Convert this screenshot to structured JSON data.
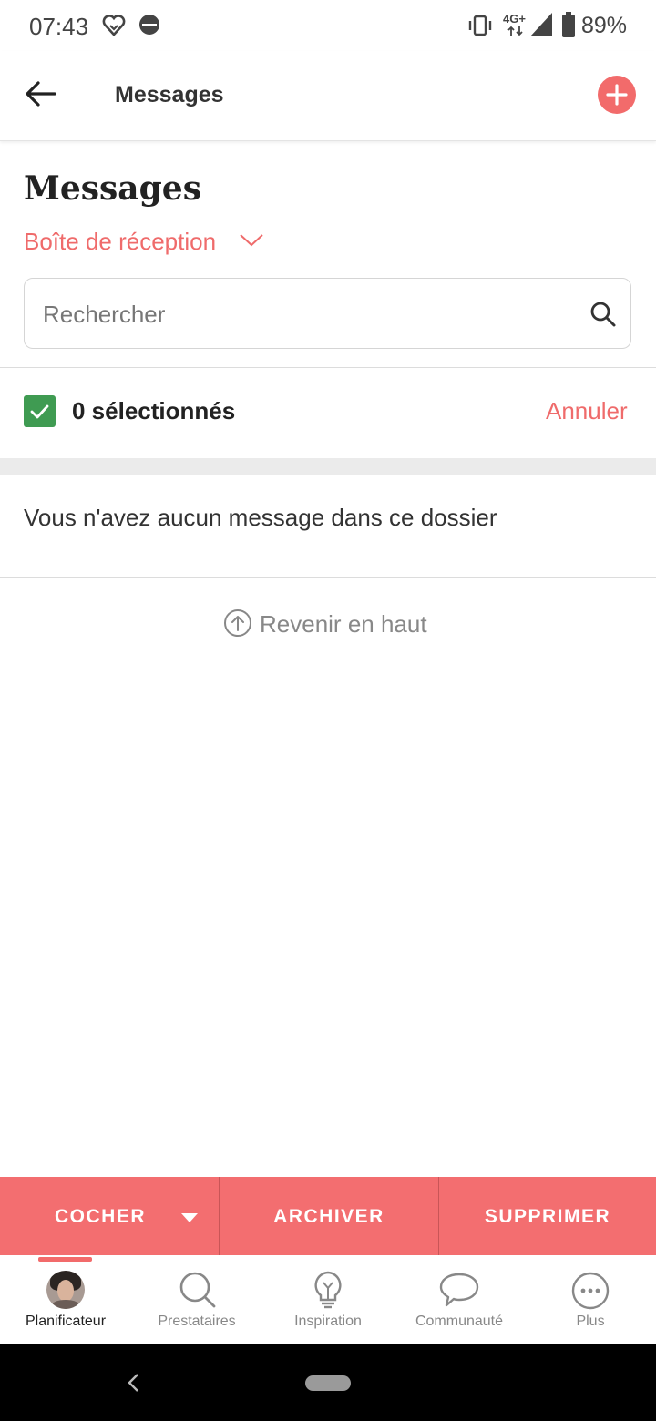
{
  "status_bar": {
    "time": "07:43",
    "network": "4G+",
    "battery": "89%",
    "icons": [
      "heart-outline-icon",
      "circle-half-icon",
      "vibrate-icon",
      "signal-icon",
      "battery-icon"
    ]
  },
  "app_bar": {
    "title": "Messages",
    "back_icon": "arrow-left-icon",
    "add_icon": "plus-circle-icon"
  },
  "page": {
    "heading": "Messages",
    "folder_label": "Boîte de réception"
  },
  "search": {
    "placeholder": "Rechercher",
    "value": ""
  },
  "selection": {
    "count_label": "0 sélectionnés",
    "cancel_label": "Annuler",
    "checked": true
  },
  "empty_state": {
    "message": "Vous n'avez aucun message dans ce dossier",
    "back_to_top": "Revenir en haut"
  },
  "actions": {
    "check_label": "COCHER",
    "archive_label": "ARCHIVER",
    "delete_label": "SUPPRIMER"
  },
  "bottom_nav": {
    "items": [
      {
        "label": "Planificateur",
        "icon": "avatar",
        "active": true
      },
      {
        "label": "Prestataires",
        "icon": "search-icon"
      },
      {
        "label": "Inspiration",
        "icon": "lightbulb-icon"
      },
      {
        "label": "Communauté",
        "icon": "chat-bubble-icon"
      },
      {
        "label": "Plus",
        "icon": "more-dots-icon"
      }
    ]
  },
  "colors": {
    "accent": "#f26b6b",
    "action_bar": "#f36e70",
    "checkbox": "#3f9b52"
  }
}
